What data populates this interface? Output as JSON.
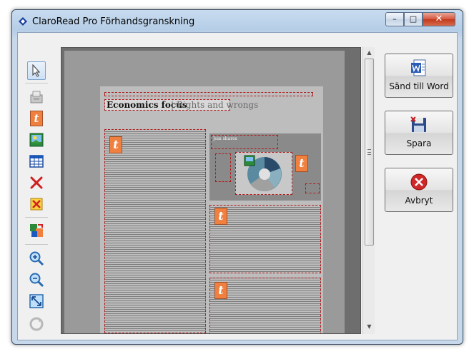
{
  "window": {
    "title": "ClaroRead Pro Förhandsgranskning",
    "controls": {
      "minimize": "–",
      "maximize": "□",
      "close": "✕"
    }
  },
  "toolbar": {
    "tools": [
      {
        "name": "select-pointer-icon",
        "active": true
      },
      {
        "name": "scanner-icon"
      },
      {
        "name": "text-zone-icon"
      },
      {
        "name": "picture-zone-icon"
      },
      {
        "name": "table-zone-icon"
      },
      {
        "name": "delete-zone-icon"
      },
      {
        "name": "delete-all-zones-icon"
      },
      {
        "name": "auto-zone-icon"
      },
      {
        "name": "zoom-in-icon"
      },
      {
        "name": "zoom-out-icon"
      },
      {
        "name": "fit-page-icon"
      },
      {
        "name": "rotate-icon"
      }
    ]
  },
  "document": {
    "heading": "Economics focus",
    "heading_pipe": "|",
    "subheading": "Rights and wrongs",
    "chart_caption": "Join shares",
    "text_zone_marker": "t"
  },
  "actions": {
    "send_to_word": "Sänd till Word",
    "save": "Spara",
    "cancel": "Avbryt"
  },
  "colors": {
    "zone_border": "#b01818",
    "text_marker": "#f08040"
  }
}
